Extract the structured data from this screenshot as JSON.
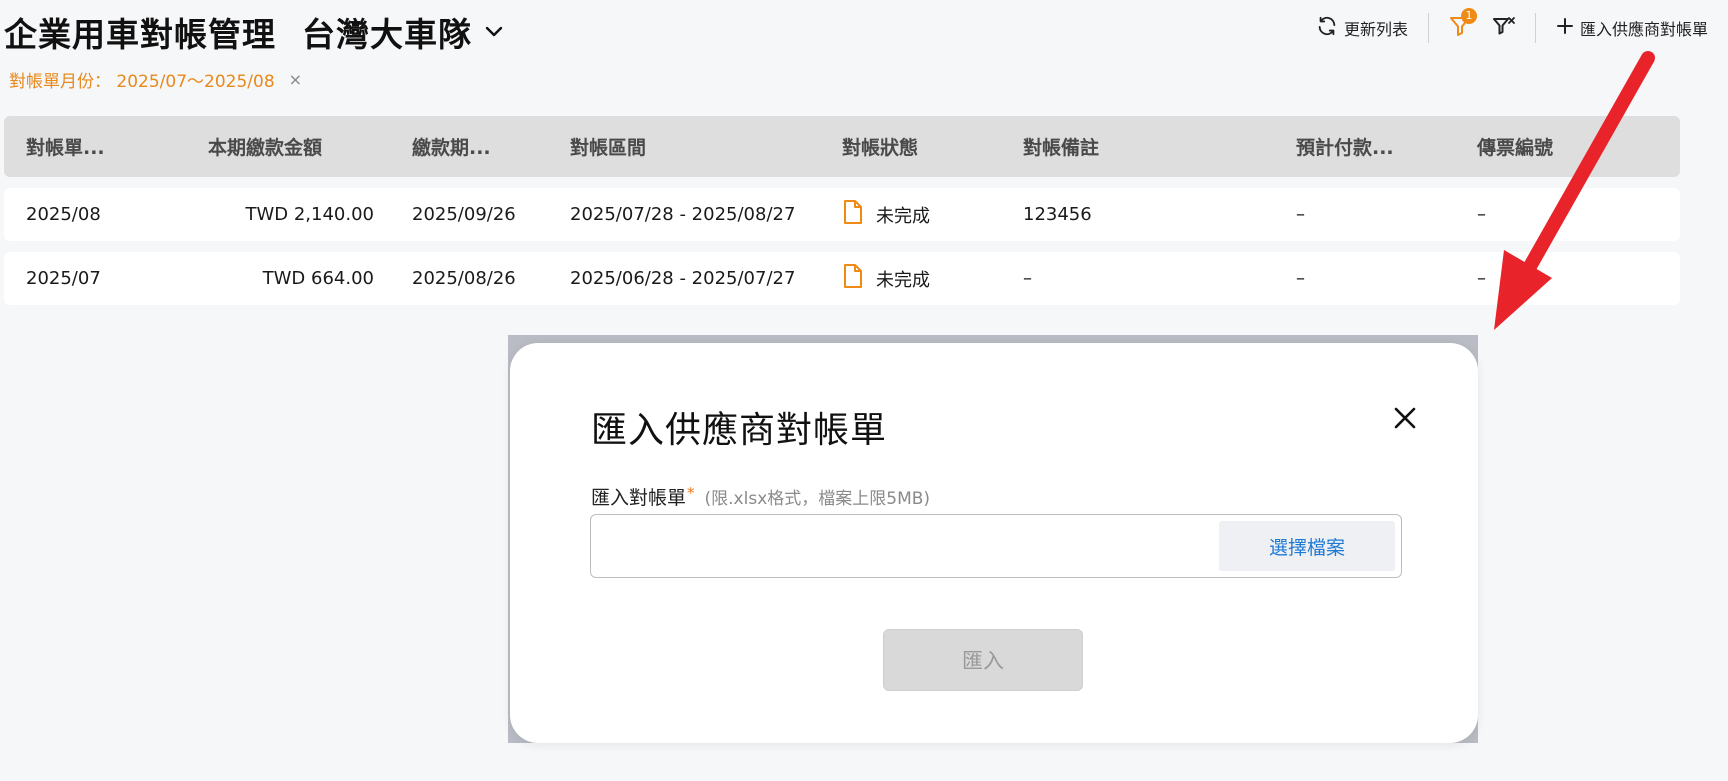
{
  "header": {
    "title": "企業用車對帳管理",
    "fleet": "台灣大車隊",
    "toolbar": {
      "refresh_label": "更新列表",
      "filter_badge": "1",
      "import_label": "匯入供應商對帳單"
    },
    "filter_chip": "對帳單月份： 2025/07～2025/08",
    "chip_close": "×"
  },
  "table": {
    "columns": [
      "對帳單...",
      "本期繳款金額",
      "繳款期...",
      "對帳區間",
      "對帳狀態",
      "對帳備註",
      "預計付款...",
      "傳票編號"
    ],
    "rows": [
      {
        "month": "2025/08",
        "amount": "TWD 2,140.00",
        "due": "2025/09/26",
        "range": "2025/07/28 - 2025/08/27",
        "status": "未完成",
        "note": "123456",
        "pay": "–",
        "voucher": "–"
      },
      {
        "month": "2025/07",
        "amount": "TWD 664.00",
        "due": "2025/08/26",
        "range": "2025/06/28 - 2025/07/27",
        "status": "未完成",
        "note": "–",
        "pay": "–",
        "voucher": "–"
      }
    ]
  },
  "dialog": {
    "title": "匯入供應商對帳單",
    "field_label": "匯入對帳單",
    "required_mark": "*",
    "hint": "(限.xlsx格式，檔案上限5MB)",
    "choose_file": "選擇檔案",
    "submit": "匯入"
  },
  "colors": {
    "accent_orange": "#ef8a14",
    "link_blue": "#1f7ad4",
    "annotation_red": "#e8232a"
  },
  "icons": [
    "refresh-icon",
    "filter-icon",
    "filter-clear-icon",
    "plus-icon",
    "chevron-down-icon",
    "document-icon",
    "close-icon",
    "arrow-annotation"
  ]
}
